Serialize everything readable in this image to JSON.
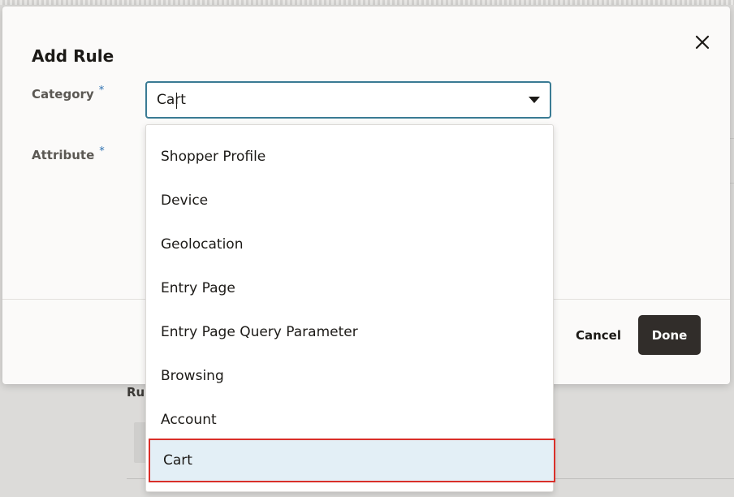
{
  "background": {
    "partial_label": "Rul"
  },
  "modal": {
    "title": "Add Rule",
    "close_label": "✕",
    "fields": {
      "category": {
        "label": "Category",
        "required_mark": "*",
        "value": "Cart"
      },
      "attribute": {
        "label": "Attribute",
        "required_mark": "*"
      }
    },
    "footer": {
      "cancel_label": "Cancel",
      "done_label": "Done"
    }
  },
  "dropdown": {
    "options": [
      {
        "label": "Shopper Profile"
      },
      {
        "label": "Device"
      },
      {
        "label": "Geolocation"
      },
      {
        "label": "Entry Page"
      },
      {
        "label": "Entry Page Query Parameter"
      },
      {
        "label": "Browsing"
      },
      {
        "label": "Account"
      },
      {
        "label": "Cart"
      }
    ],
    "selected_index": 7
  },
  "colors": {
    "accent_border": "#3a7b94",
    "selected_bg": "#e3eff6",
    "highlight_outline": "#d9302a",
    "primary_button": "#312d2a",
    "required": "#2b6fb0"
  }
}
